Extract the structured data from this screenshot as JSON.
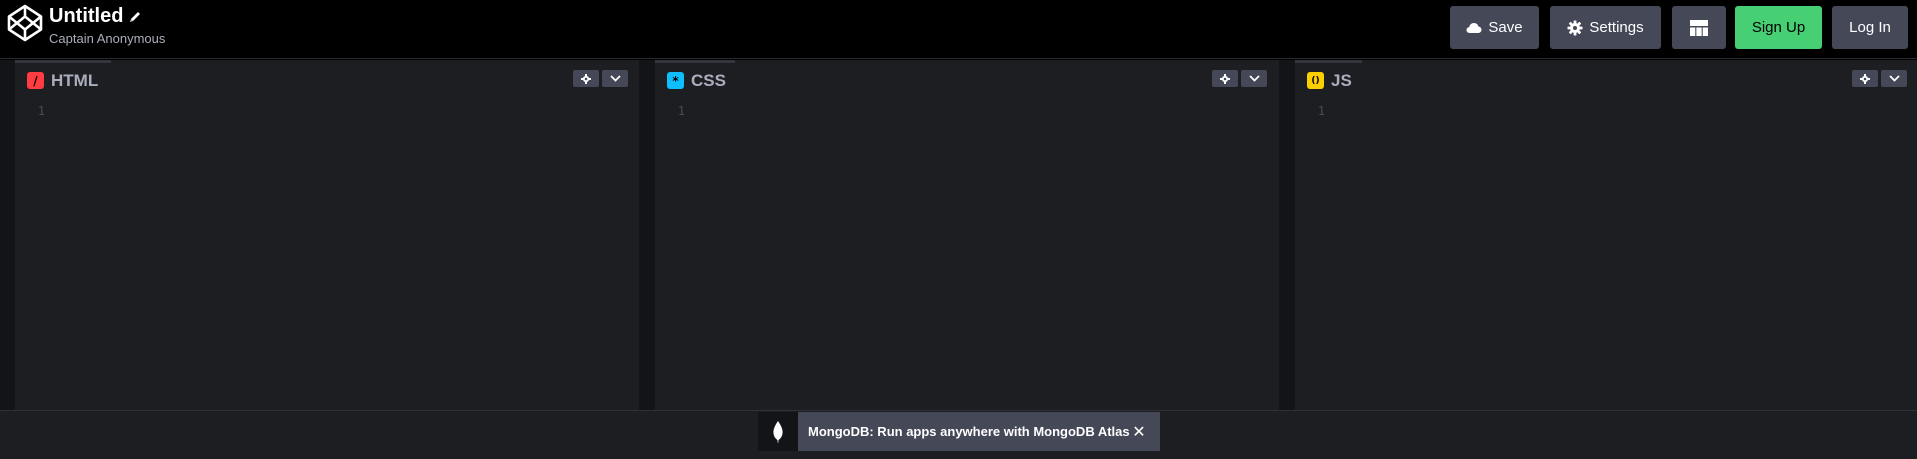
{
  "header": {
    "title": "Untitled",
    "author": "Captain Anonymous",
    "save_label": "Save",
    "settings_label": "Settings",
    "signup_label": "Sign Up",
    "login_label": "Log In"
  },
  "editors": [
    {
      "label": "HTML",
      "icon": "html-icon",
      "icon_glyph": "/",
      "icon_color": "#ff3c41",
      "line": "1"
    },
    {
      "label": "CSS",
      "icon": "css-icon",
      "icon_glyph": "*",
      "icon_color": "#0ebeff",
      "line": "1"
    },
    {
      "label": "JS",
      "icon": "js-icon",
      "icon_glyph": "()",
      "icon_color": "#fcd000",
      "line": "1"
    }
  ],
  "ad": {
    "text": "MongoDB: Run apps anywhere with MongoDB Atlas",
    "close_glyph": "✕"
  },
  "colors": {
    "accent_green": "#47cf73",
    "button_gray": "#444857",
    "editor_bg": "#1d1e22"
  }
}
